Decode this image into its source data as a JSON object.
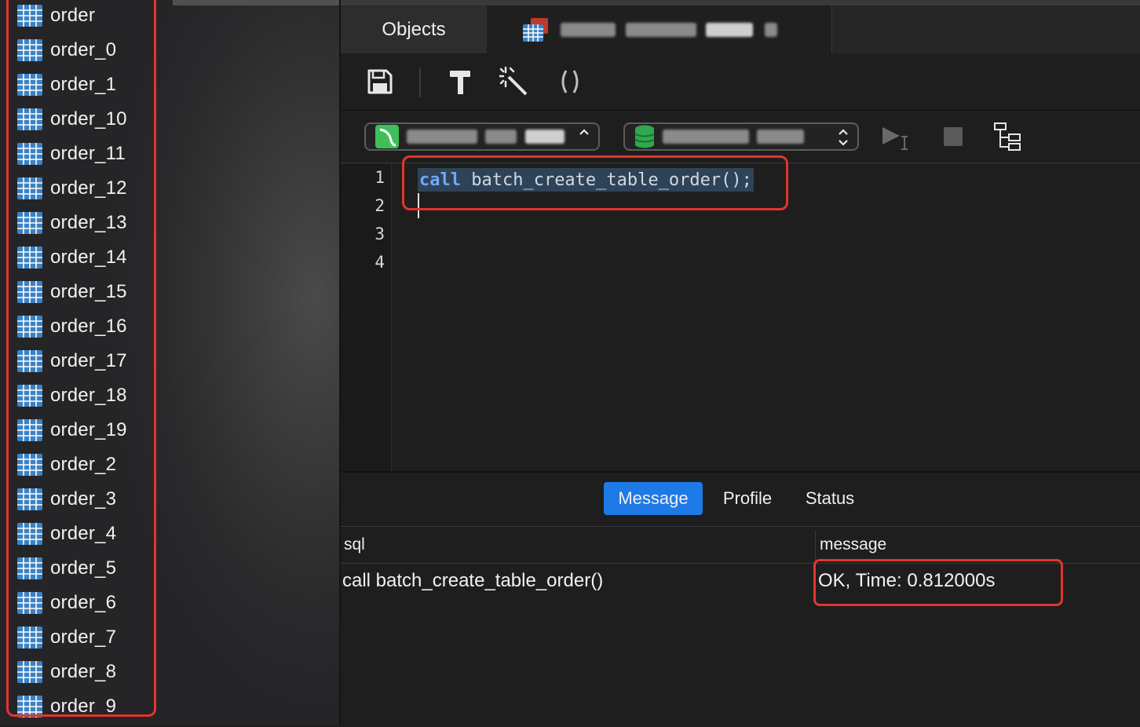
{
  "sidebar": {
    "tables": [
      "order",
      "order_0",
      "order_1",
      "order_10",
      "order_11",
      "order_12",
      "order_13",
      "order_14",
      "order_15",
      "order_16",
      "order_17",
      "order_18",
      "order_19",
      "order_2",
      "order_3",
      "order_4",
      "order_5",
      "order_6",
      "order_7",
      "order_8",
      "order_9"
    ]
  },
  "tabs": {
    "objects": "Objects"
  },
  "toolbar": {
    "icons": [
      "save-icon",
      "beautify-hammer-icon",
      "magic-wand-icon",
      "parentheses-icon"
    ]
  },
  "editor": {
    "line_numbers": [
      "1",
      "2",
      "3",
      "4"
    ],
    "line1_keyword": "call",
    "line1_text": " batch_create_table_order();"
  },
  "results": {
    "tabs": {
      "message": "Message",
      "profile": "Profile",
      "status": "Status"
    },
    "columns": {
      "sql": "sql",
      "message": "message"
    },
    "row": {
      "sql": "call batch_create_table_order()",
      "message": "OK, Time: 0.812000s"
    }
  },
  "colors": {
    "accent": "#1e7ae6",
    "highlight_border": "#e3342f",
    "keyword": "#6ea8ff",
    "db_icon": "#2fa84f",
    "conn_icon": "#3fbf5a"
  }
}
